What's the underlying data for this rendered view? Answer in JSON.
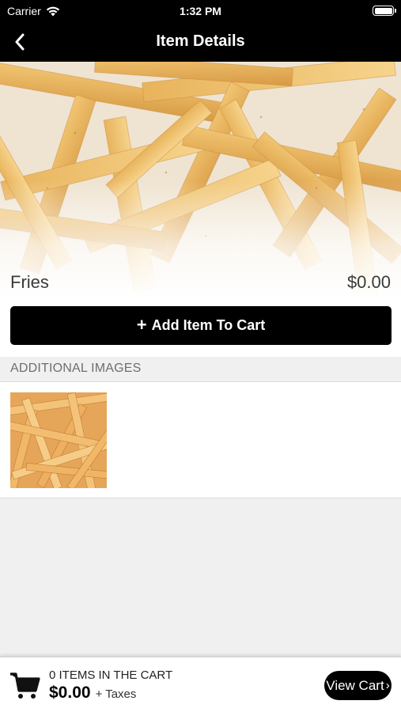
{
  "status_bar": {
    "carrier": "Carrier",
    "time": "1:32 PM"
  },
  "nav": {
    "title": "Item Details",
    "back_icon": "chevron-left-icon"
  },
  "item": {
    "name": "Fries",
    "price": "$0.00",
    "image": "fries-photo"
  },
  "actions": {
    "add_to_cart_icon": "+",
    "add_to_cart_label": "Add Item To Cart"
  },
  "additional_images": {
    "header": "ADDITIONAL IMAGES",
    "images": [
      "fries-thumbnail"
    ]
  },
  "cart_bar": {
    "items_count": "0 ITEMS IN THE CART",
    "total": "$0.00",
    "taxes": "+ Taxes",
    "view_cart": "View Cart",
    "view_cart_chevron": "›",
    "cart_icon": "shopping-cart-icon"
  },
  "colors": {
    "bar_background": "#000000",
    "page_background": "#f0f0f0",
    "accent": "#000000"
  }
}
